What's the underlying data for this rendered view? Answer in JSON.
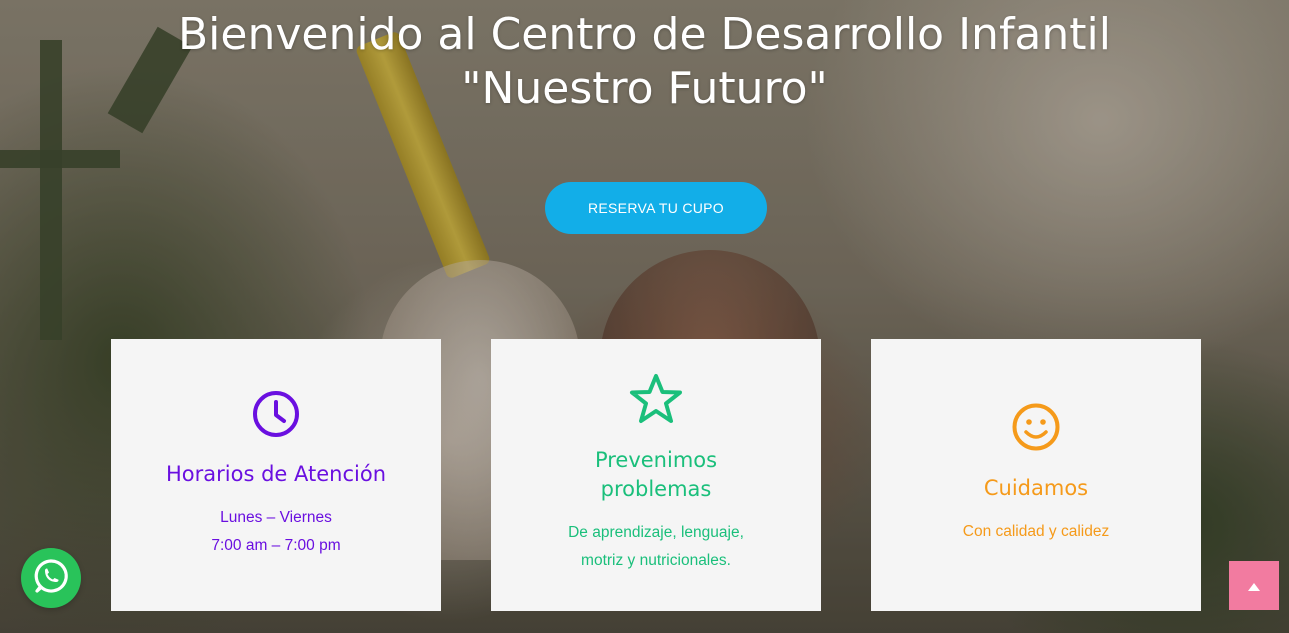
{
  "hero": {
    "title_line1": "Bienvenido al Centro de Desarrollo Infantil",
    "title_line2": "\"Nuestro Futuro\"",
    "cta_label": "RESERVA TU CUPO",
    "accent_color": "#12aee8"
  },
  "cards": [
    {
      "icon": "clock-icon",
      "title": "Horarios de Atención",
      "lines": [
        "Lunes – Viernes",
        "7:00 am – 7:00 pm"
      ],
      "color": "#6a0fe0"
    },
    {
      "icon": "star-icon",
      "title_line1": "Prevenimos",
      "title_line2": "problemas",
      "lines": [
        "De aprendizaje, lenguaje,",
        "motriz y nutricionales."
      ],
      "color": "#1abf7b"
    },
    {
      "icon": "smiley-icon",
      "title": "Cuidamos",
      "lines": [
        "Con calidad y calidez"
      ],
      "color": "#f59a1a"
    }
  ],
  "floating": {
    "whatsapp_icon": "whatsapp-icon",
    "whatsapp_color": "#29c35a",
    "back_to_top_icon": "arrow-up-icon",
    "back_to_top_color": "#f27ba0"
  }
}
